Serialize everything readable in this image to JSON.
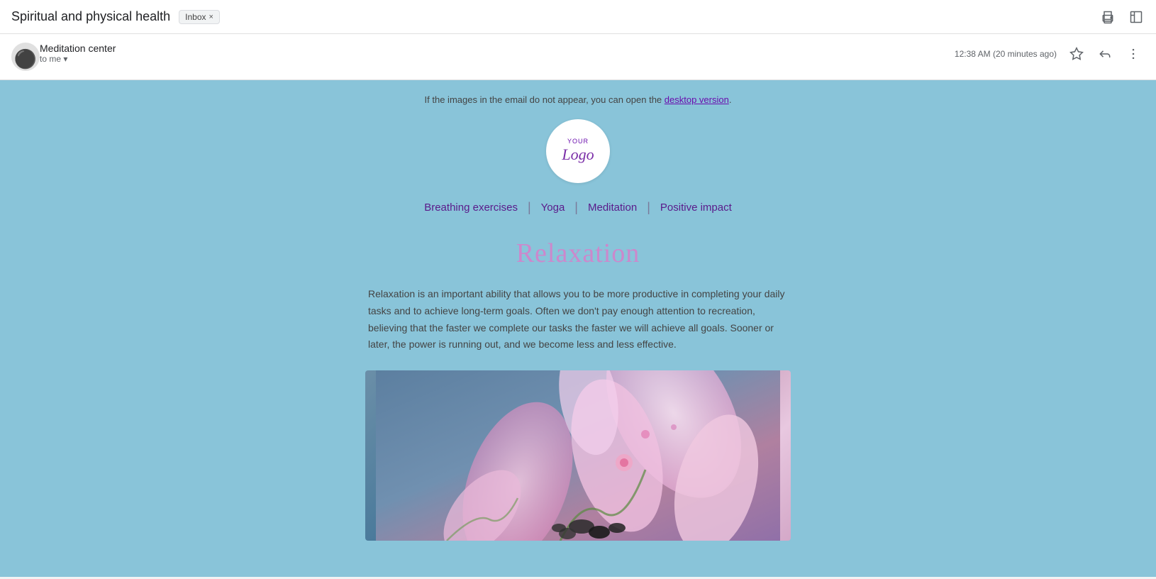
{
  "page": {
    "title": "Spiritual and physical health",
    "inbox_badge": "Inbox",
    "inbox_badge_x": "×"
  },
  "top_bar": {
    "print_icon": "🖨",
    "new_window_icon": "⤢"
  },
  "email": {
    "sender_name": "Meditation center",
    "to_label": "to me",
    "to_arrow": "▾",
    "time": "12:38 AM (20 minutes ago)",
    "star_icon": "☆",
    "reply_icon": "↩",
    "more_icon": "⋮"
  },
  "email_body": {
    "notice_text": "If the images in the email do not appear, you can open the",
    "notice_link": "desktop version",
    "notice_period": ".",
    "logo_your": "YOUR",
    "logo_logo": "Logo",
    "nav_items": [
      {
        "label": "Breathing exercises"
      },
      {
        "label": "Yoga"
      },
      {
        "label": "Meditation"
      },
      {
        "label": "Positive impact"
      }
    ],
    "nav_separator": "|",
    "relaxation_title": "Relaxation",
    "relaxation_body": "Relaxation is an important ability that allows you to be more productive in completing your daily tasks and to achieve long-term goals. Often we don't pay enough attention to recreation, believing that the faster we complete our tasks the faster we will achieve all goals. Sooner or later, the power is running out, and we become less and less effective."
  }
}
